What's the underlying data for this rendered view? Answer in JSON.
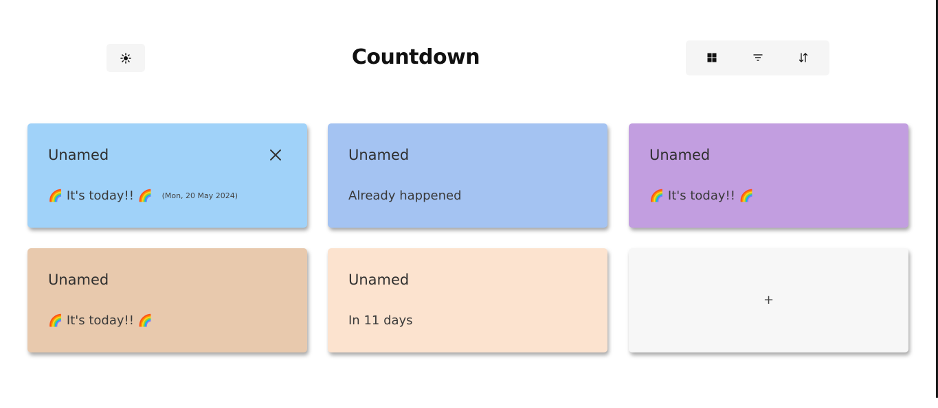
{
  "header": {
    "title": "Countdown",
    "theme_button_icon": "sun-icon"
  },
  "toolbar": {
    "buttons": [
      {
        "icon": "grid-view-icon"
      },
      {
        "icon": "filter-icon"
      },
      {
        "icon": "sort-icon"
      }
    ]
  },
  "cards": [
    {
      "title": "Unamed",
      "status": "It's today!!",
      "date": "(Mon, 20 May 2024)",
      "color": "#a0d2f9",
      "emoji": "🌈",
      "close_icon": "close-icon"
    },
    {
      "title": "Unamed",
      "status": "Already happened",
      "color": "#a4c3f2"
    },
    {
      "title": "Unamed",
      "status": "It's today!!",
      "color": "#c29ee0",
      "emoji": "🌈"
    },
    {
      "title": "Unamed",
      "status": "It's today!!",
      "color": "#e8c9ad",
      "emoji": "🌈"
    },
    {
      "title": "Unamed",
      "status": "In 11 days",
      "color": "#fce3cf"
    }
  ],
  "add_card": {
    "label": "+",
    "color": "#f7f7f7"
  }
}
